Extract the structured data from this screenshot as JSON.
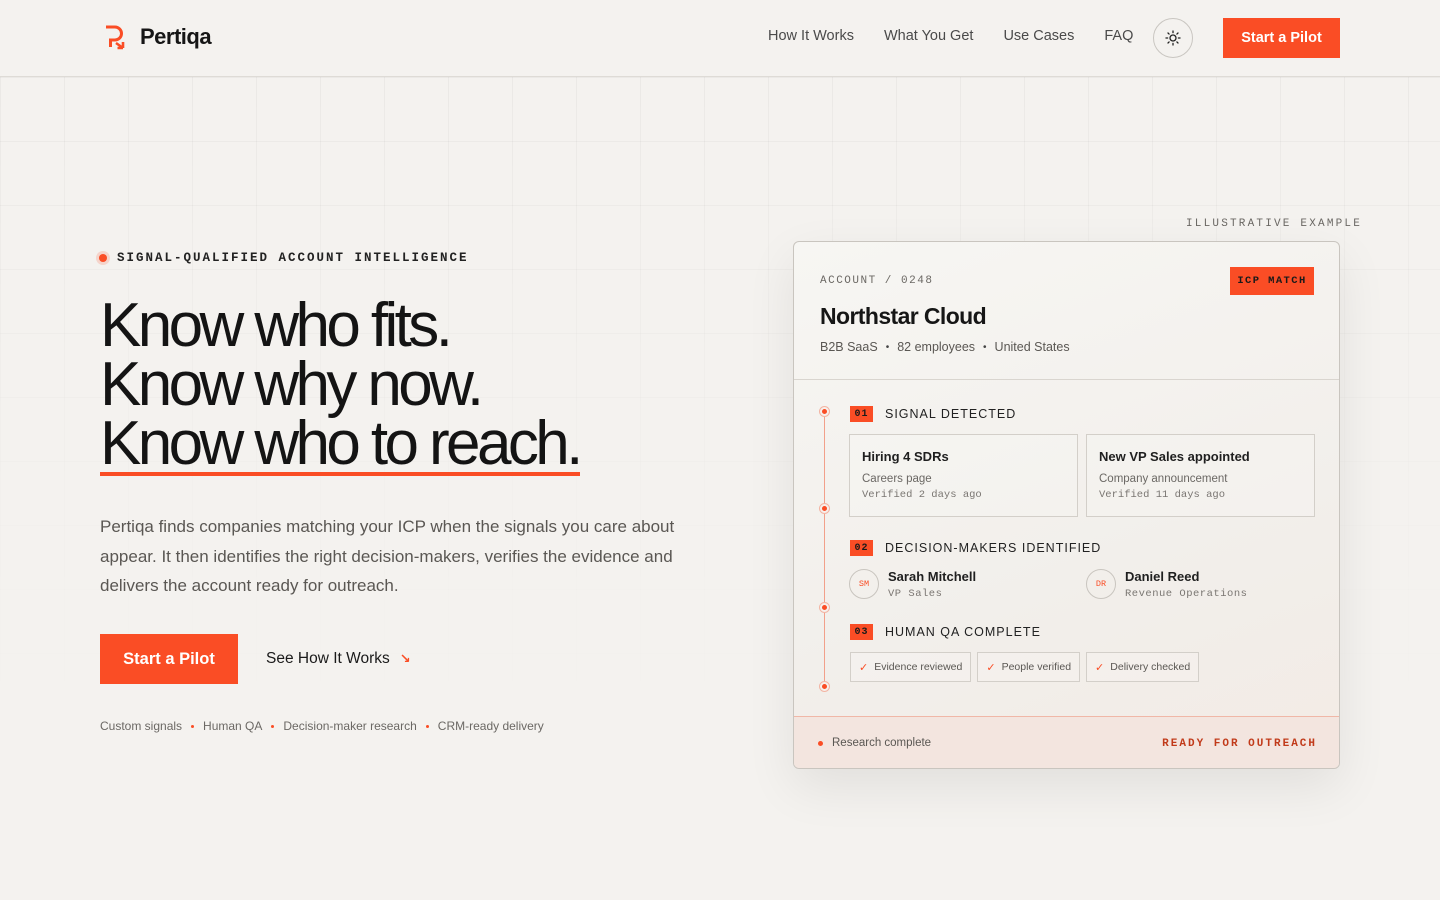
{
  "brand": {
    "name": "Pertiqa",
    "accent": "#fa4d25"
  },
  "nav": {
    "items": [
      "How It Works",
      "What You Get",
      "Use Cases",
      "FAQ"
    ]
  },
  "header": {
    "cta_label": "Start a Pilot",
    "theme_icon": "sun-icon"
  },
  "hero": {
    "eyebrow": "SIGNAL-QUALIFIED ACCOUNT INTELLIGENCE",
    "headline": [
      "Know who fits.",
      "Know why now.",
      "Know who to reach."
    ],
    "lead": "Pertiqa finds companies matching your ICP when the signals you care about appear. It then identifies the right decision-makers, verifies the evidence and delivers the account ready for outreach.",
    "primary_cta": "Start a Pilot",
    "secondary_cta": "See How It Works",
    "features": [
      "Custom signals",
      "Human QA",
      "Decision-maker research",
      "CRM-ready delivery"
    ]
  },
  "card": {
    "illustrative_label": "ILLUSTRATIVE EXAMPLE",
    "account_label": "ACCOUNT / 0248",
    "badge": "ICP MATCH",
    "account_name": "Northstar Cloud",
    "meta": [
      "B2B SaaS",
      "82 employees",
      "United States"
    ],
    "steps": [
      {
        "num": "01",
        "title": "SIGNAL DETECTED",
        "signals": [
          {
            "title": "Hiring 4 SDRs",
            "source": "Careers page",
            "verified": "Verified 2 days ago"
          },
          {
            "title": "New VP Sales appointed",
            "source": "Company announcement",
            "verified": "Verified 11 days ago"
          }
        ]
      },
      {
        "num": "02",
        "title": "DECISION-MAKERS IDENTIFIED",
        "people": [
          {
            "initials": "SM",
            "name": "Sarah Mitchell",
            "role": "VP Sales"
          },
          {
            "initials": "DR",
            "name": "Daniel Reed",
            "role": "Revenue Operations"
          }
        ]
      },
      {
        "num": "03",
        "title": "HUMAN QA COMPLETE",
        "checks": [
          "Evidence reviewed",
          "People verified",
          "Delivery checked"
        ]
      }
    ],
    "footer": {
      "status": "Research complete",
      "ready": "READY FOR OUTREACH"
    }
  }
}
